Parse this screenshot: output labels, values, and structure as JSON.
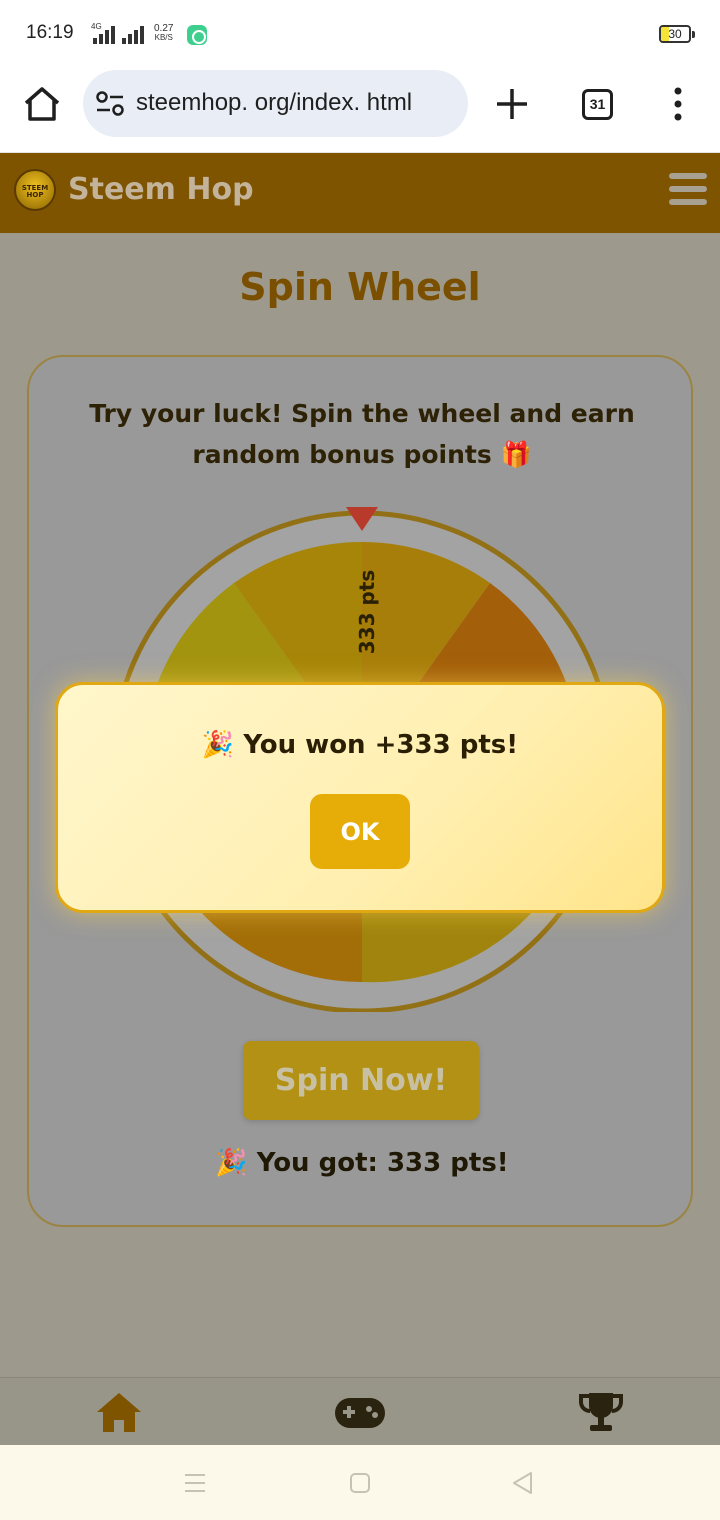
{
  "status_bar": {
    "time": "16:19",
    "network_tag": "4G",
    "speed_value": "0.27",
    "speed_unit": "KB/S",
    "battery": "30"
  },
  "browser": {
    "url": "steemhop. org/index. html",
    "tab_count": "31"
  },
  "app": {
    "brand_name": "Steem Hop",
    "logo_text": "STEEM HOP",
    "accent_color": "#7f5400",
    "gold_color": "#e6ad08"
  },
  "main": {
    "title": "Spin Wheel",
    "description": "Try your luck! Spin the wheel and earn random bonus points 🎁",
    "wheel_label": "333 pts",
    "spin_button": "Spin Now!",
    "result_text": "🎉 You got: 333 pts!"
  },
  "modal": {
    "message": "🎉 You won +333 pts!",
    "ok_label": "OK"
  },
  "bottom_nav": {
    "items": [
      {
        "icon": "home-icon",
        "active": true
      },
      {
        "icon": "gamepad-icon",
        "active": false
      },
      {
        "icon": "trophy-icon",
        "active": false
      }
    ]
  },
  "system_nav": {
    "icons": [
      "recents-icon",
      "home-square-icon",
      "back-triangle-icon"
    ]
  }
}
